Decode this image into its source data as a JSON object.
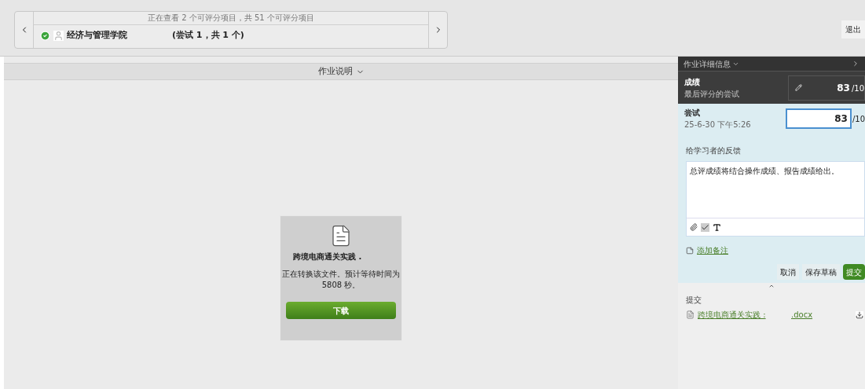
{
  "navigator": {
    "summary": "正在查看 2 个可评分项目，共 51 个可评分项目",
    "student": "经济与管理学院",
    "attempt": "(尝试 1，共 1 个)",
    "graded": true
  },
  "exit_button": "退出",
  "instructions_header": "作业说明",
  "preview": {
    "file_name": "跨境电商通关实践 .",
    "message": "正在转换该文件。预计等待时间为 5808 秒。",
    "download": "下载"
  },
  "details": {
    "title": "作业详细信息",
    "grade": {
      "label": "成绩",
      "sublabel": "最后评分的尝试",
      "value": "83",
      "max": "/10"
    },
    "attempt": {
      "label": "尝试",
      "date": "25-6-30 下午5:26",
      "value": "83",
      "max": "/10"
    },
    "feedback_label": "给学习者的反馈",
    "feedback": "总评成绩将结合操作成绩、报告成绩给出。",
    "add_note": "添加备注",
    "buttons": [
      {
        "label": "取消",
        "kind": "plain"
      },
      {
        "label": "保存草稿",
        "kind": "plain"
      },
      {
        "label": "提交",
        "kind": "primary"
      }
    ],
    "submission": {
      "label": "提交",
      "file_name": "跨境电商通关实践 :",
      "extension": ".docx"
    }
  }
}
